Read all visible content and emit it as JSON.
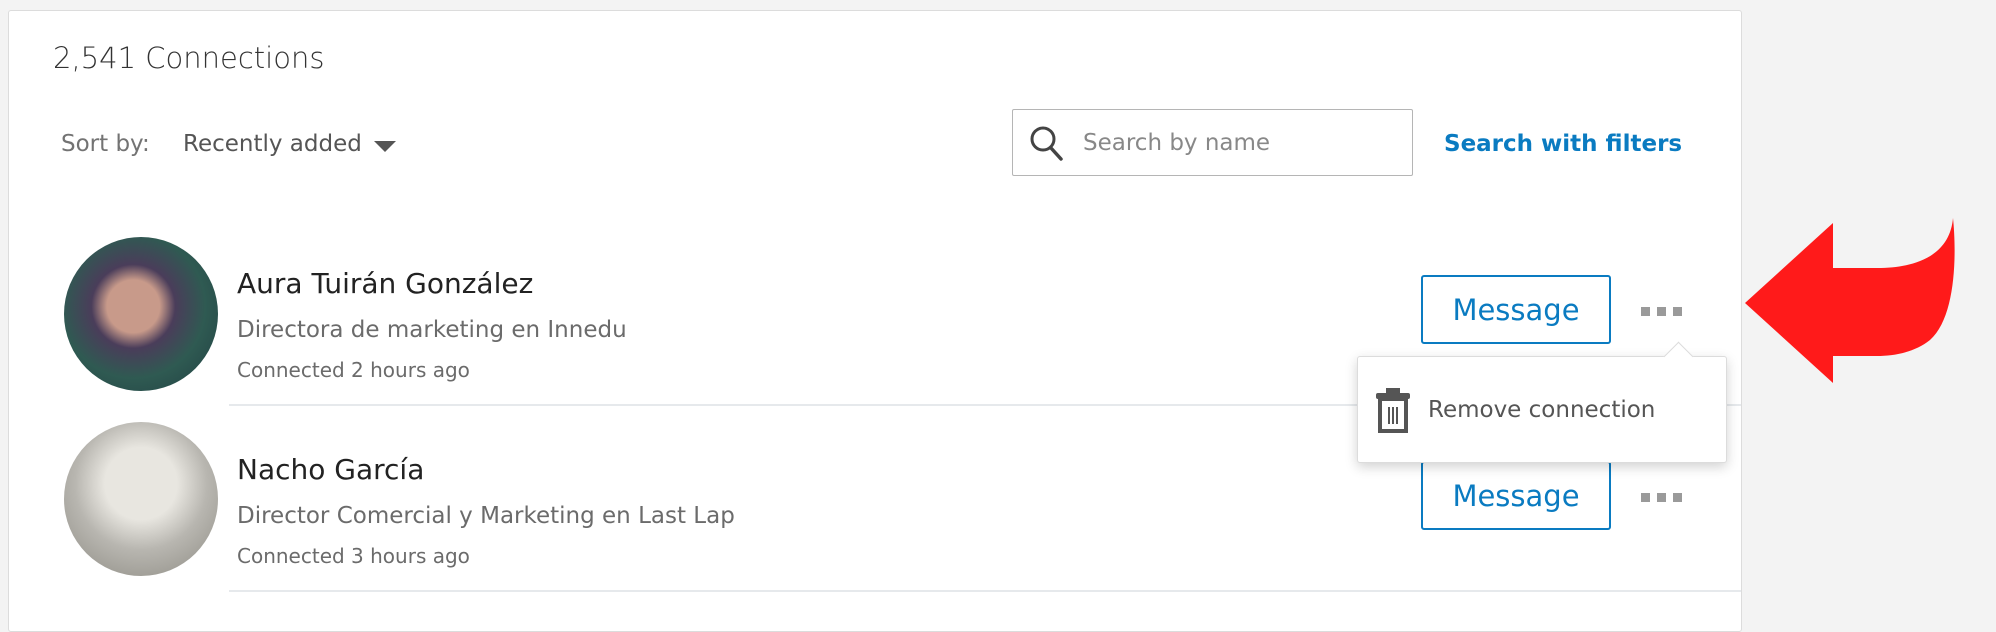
{
  "header": {
    "title": "2,541 Connections"
  },
  "sort": {
    "label": "Sort by:",
    "value": "Recently added"
  },
  "search": {
    "placeholder": "Search by name",
    "value": "",
    "filters_link": "Search with filters"
  },
  "connections": [
    {
      "name": "Aura Tuirán González",
      "headline": "Directora de marketing en Innedu",
      "connected": "Connected 2 hours ago",
      "message_label": "Message"
    },
    {
      "name": "Nacho García",
      "headline": "Director Comercial y Marketing en Last Lap",
      "connected": "Connected 3 hours ago",
      "message_label": "Message"
    }
  ],
  "menu": {
    "remove_label": "Remove connection",
    "icon": "trash-icon"
  },
  "colors": {
    "accent": "#0a7bc1",
    "annotation_arrow": "#ff1a1a"
  }
}
